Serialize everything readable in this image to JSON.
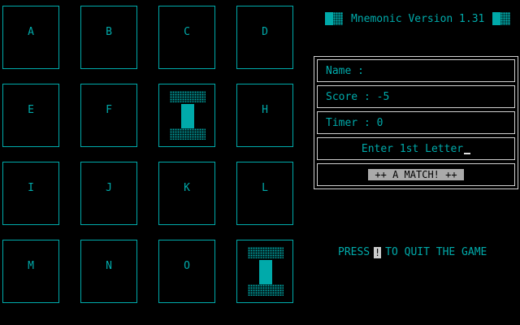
{
  "board": {
    "cards": [
      {
        "letter": "A",
        "revealed": false
      },
      {
        "letter": "B",
        "revealed": false
      },
      {
        "letter": "C",
        "revealed": false
      },
      {
        "letter": "D",
        "revealed": false
      },
      {
        "letter": "E",
        "revealed": false
      },
      {
        "letter": "F",
        "revealed": false
      },
      {
        "letter": "",
        "revealed": true,
        "symbol": "I-beam"
      },
      {
        "letter": "H",
        "revealed": false
      },
      {
        "letter": "I",
        "revealed": false
      },
      {
        "letter": "J",
        "revealed": false
      },
      {
        "letter": "K",
        "revealed": false
      },
      {
        "letter": "L",
        "revealed": false
      },
      {
        "letter": "M",
        "revealed": false
      },
      {
        "letter": "N",
        "revealed": false
      },
      {
        "letter": "O",
        "revealed": false
      },
      {
        "letter": "",
        "revealed": true,
        "symbol": "I-beam"
      }
    ]
  },
  "title": "Mnemonic Version 1.31",
  "status": {
    "name": "Name  :",
    "score": "Score : -5",
    "timer": "Timer : 0",
    "prompt": "Enter 1st Letter",
    "match": "++ A MATCH! ++"
  },
  "quit": {
    "before": "PRESS",
    "key": "!",
    "after": "TO QUIT THE GAME"
  },
  "colors": {
    "primary": "#00aaaa",
    "background": "#000000",
    "frame": "#cfcfcf"
  }
}
